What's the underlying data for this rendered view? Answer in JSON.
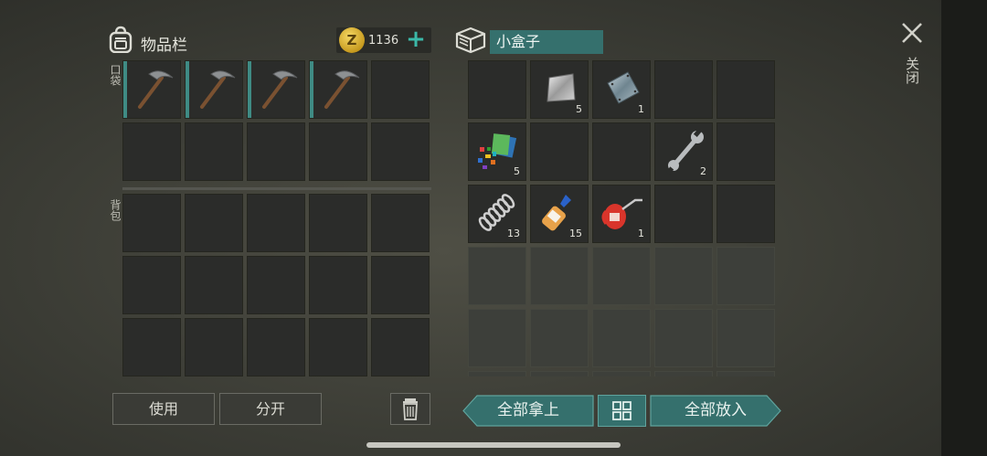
{
  "inventory": {
    "title": "物品栏",
    "pocket_label": "口袋",
    "backpack_label": "背包",
    "coins": "1136",
    "coin_symbol": "Z",
    "plus": "+",
    "pocket_slots": [
      {
        "item": "pickaxe-icon",
        "count": ""
      },
      {
        "item": "pickaxe-icon",
        "count": ""
      },
      {
        "item": "pickaxe-icon",
        "count": ""
      },
      {
        "item": "pickaxe-icon",
        "count": ""
      },
      {
        "item": "",
        "count": ""
      },
      {
        "item": "",
        "count": ""
      },
      {
        "item": "",
        "count": ""
      },
      {
        "item": "",
        "count": ""
      },
      {
        "item": "",
        "count": ""
      },
      {
        "item": "",
        "count": ""
      }
    ],
    "backpack_slots": [
      {
        "item": "",
        "count": ""
      },
      {
        "item": "",
        "count": ""
      },
      {
        "item": "",
        "count": ""
      },
      {
        "item": "",
        "count": ""
      },
      {
        "item": "",
        "count": ""
      },
      {
        "item": "",
        "count": ""
      },
      {
        "item": "",
        "count": ""
      },
      {
        "item": "",
        "count": ""
      },
      {
        "item": "",
        "count": ""
      },
      {
        "item": "",
        "count": ""
      },
      {
        "item": "",
        "count": ""
      },
      {
        "item": "",
        "count": ""
      },
      {
        "item": "",
        "count": ""
      },
      {
        "item": "",
        "count": ""
      },
      {
        "item": "",
        "count": ""
      }
    ],
    "use_label": "使用",
    "split_label": "分开"
  },
  "container": {
    "name": "小盒子",
    "slots": [
      {
        "item": "",
        "count": ""
      },
      {
        "item": "metal-sheet-icon",
        "count": "5"
      },
      {
        "item": "steel-plate-icon",
        "count": "1"
      },
      {
        "item": "",
        "count": ""
      },
      {
        "item": "",
        "count": ""
      },
      {
        "item": "plastic-parts-icon",
        "count": "5"
      },
      {
        "item": "",
        "count": ""
      },
      {
        "item": "",
        "count": ""
      },
      {
        "item": "wrench-icon",
        "count": "2"
      },
      {
        "item": "",
        "count": ""
      },
      {
        "item": "spring-icon",
        "count": "13"
      },
      {
        "item": "glue-icon",
        "count": "15"
      },
      {
        "item": "oil-can-icon",
        "count": "1"
      },
      {
        "item": "",
        "count": ""
      },
      {
        "item": "",
        "count": ""
      }
    ],
    "faded_slot_count": 15,
    "take_all_label": "全部拿上",
    "put_all_label": "全部放入"
  },
  "close_label": "关闭",
  "colors": {
    "accent": "#35706d",
    "accent_light": "#5fa39d",
    "coin": "#e8c242"
  }
}
